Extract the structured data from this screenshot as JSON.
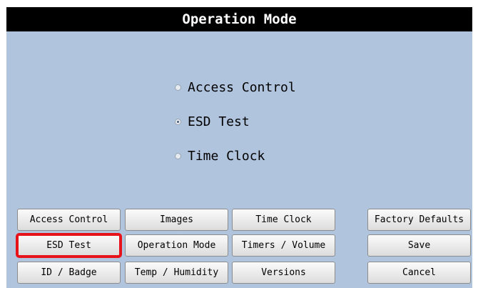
{
  "title": "Operation Mode",
  "modes": [
    {
      "label": "Access Control",
      "selected": false
    },
    {
      "label": "ESD Test",
      "selected": true
    },
    {
      "label": "Time Clock",
      "selected": false
    }
  ],
  "buttons": {
    "access_control": "Access Control",
    "images": "Images",
    "time_clock": "Time Clock",
    "factory_defaults": "Factory Defaults",
    "esd_test": "ESD Test",
    "operation_mode": "Operation Mode",
    "timers_volume": "Timers / Volume",
    "save": "Save",
    "id_badge": "ID / Badge",
    "temp_humidity": "Temp / Humidity",
    "versions": "Versions",
    "cancel": "Cancel"
  },
  "colors": {
    "background": "#b0c4de",
    "titlebar": "#000000",
    "highlight": "#e8121b"
  }
}
